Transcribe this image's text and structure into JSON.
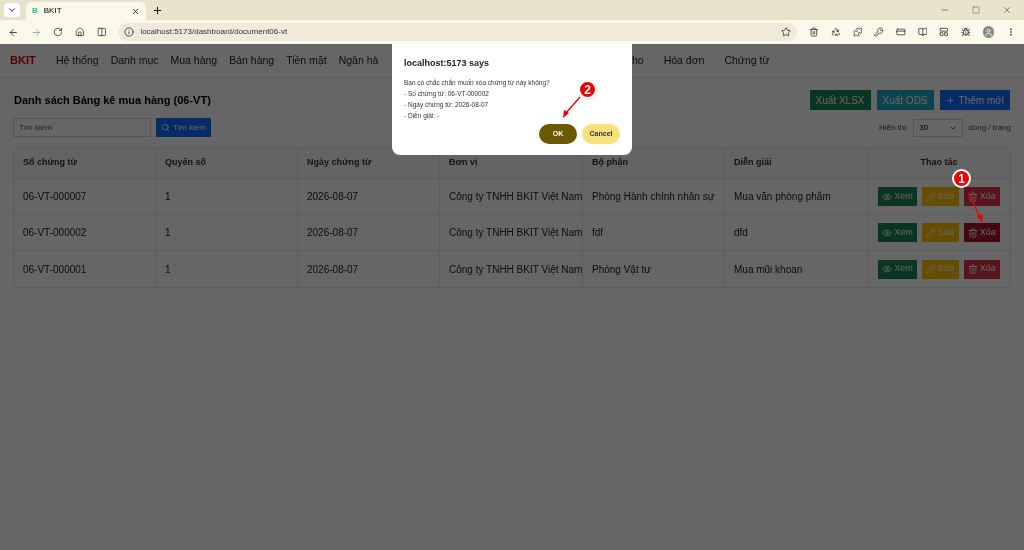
{
  "browser": {
    "tab_title": "BKIT",
    "favicon": "B",
    "url": "localhost:5173/dashboard/document06-vt"
  },
  "nav": {
    "brand": "BKIT",
    "items": [
      "Hệ thống",
      "Danh mục",
      "Mua hàng",
      "Bán hàng",
      "Tiền mặt",
      "Ngân hà"
    ],
    "items_right": [
      "ho",
      "Hóa đơn",
      "Chứng từ"
    ]
  },
  "page_title": "Danh sách Bảng kê mua hàng (06-VT)",
  "toolbar_buttons": [
    {
      "label": "Xuất XLSX",
      "kind": "xlsx"
    },
    {
      "label": "Xuất ODS",
      "kind": "ods"
    },
    {
      "label": "Thêm mới",
      "kind": "add"
    }
  ],
  "search": {
    "placeholder": "Tìm kiếm",
    "button": "Tìm kiếm"
  },
  "page_size": {
    "label": "Hiển thị:",
    "value": "30",
    "suffix": "dòng / trang"
  },
  "table": {
    "columns": [
      "Số chứng từ",
      "Quyển số",
      "Ngày chứng từ",
      "Đơn vị",
      "Bộ phận",
      "Diễn giải",
      "Thao tác"
    ],
    "rows": [
      {
        "cells": [
          "06-VT-000007",
          "1",
          "2026-08-07",
          "Công ty TNHH BKIT Việt Nam",
          "Phòng Hành chính nhân sự",
          "Mua văn phòng phẩm"
        ],
        "actions": [
          {
            "label": "Xem",
            "kind": "view",
            "hovered": false
          },
          {
            "label": "Sửa",
            "kind": "edit",
            "hovered": false
          },
          {
            "label": "Xóa",
            "kind": "delete",
            "hovered": false
          }
        ]
      },
      {
        "cells": [
          "06-VT-000002",
          "1",
          "2026-08-07",
          "Công ty TNHH BKIT Việt Nam",
          "fdf",
          "dfd"
        ],
        "actions": [
          {
            "label": "Xem",
            "kind": "view",
            "hovered": false
          },
          {
            "label": "Sửa",
            "kind": "edit",
            "hovered": false
          },
          {
            "label": "Xóa",
            "kind": "delete",
            "hovered": true
          }
        ]
      },
      {
        "cells": [
          "06-VT-000001",
          "1",
          "2026-08-07",
          "Công ty TNHH BKIT Việt Nam",
          "Phòng Vật tư",
          "Mua mũi khoan"
        ],
        "actions": [
          {
            "label": "Xem",
            "kind": "view",
            "hovered": false
          },
          {
            "label": "Sửa",
            "kind": "edit",
            "hovered": false
          },
          {
            "label": "Xóa",
            "kind": "delete",
            "hovered": false
          }
        ]
      }
    ]
  },
  "dialog": {
    "title": "localhost:5173 says",
    "lines": [
      "Bạn có chắc chắn muốn xóa chứng từ này không?",
      "- Số chứng từ: 06-VT-000002",
      "- Ngày chứng từ: 2026-08-07",
      "- Diễn giải: -"
    ],
    "ok": "OK",
    "cancel": "Cancel"
  },
  "annotations": [
    {
      "label": "1",
      "kind": "row"
    },
    {
      "label": "2",
      "kind": "dialog"
    }
  ]
}
